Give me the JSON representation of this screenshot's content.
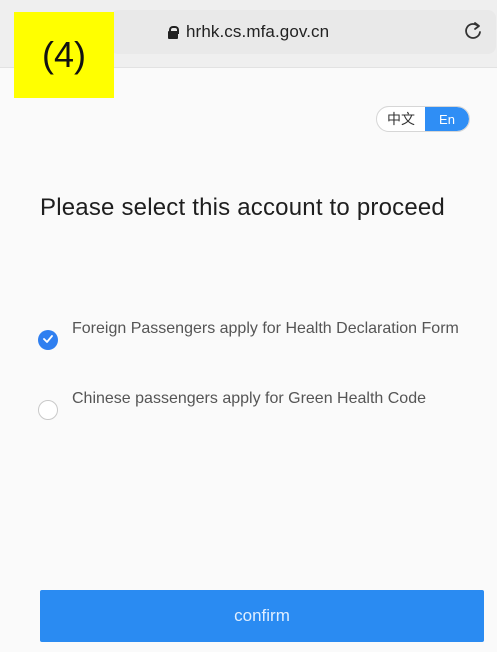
{
  "step_label": "(4)",
  "browser": {
    "url": "hrhk.cs.mfa.gov.cn",
    "lock_icon": "lock-icon",
    "reload_icon": "reload-icon"
  },
  "language_toggle": {
    "zh_label": "中文",
    "en_label": "En",
    "active": "En",
    "active_color": "#2f8ef5"
  },
  "page": {
    "heading": "Please select this account to proceed"
  },
  "options": [
    {
      "label": "Foreign Passengers apply for Health Declaration Form",
      "selected": true
    },
    {
      "label": "Chinese passengers apply for Green Health Code",
      "selected": false
    }
  ],
  "confirm": {
    "label": "confirm",
    "color": "#2a8bf2"
  }
}
